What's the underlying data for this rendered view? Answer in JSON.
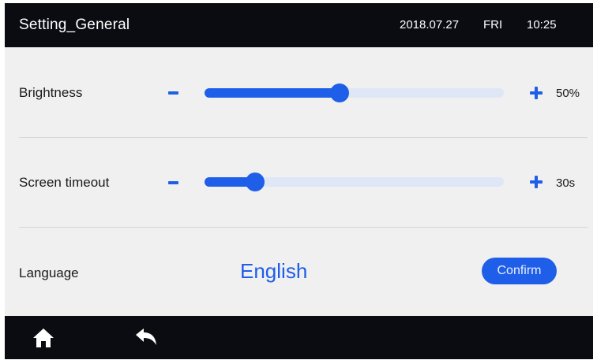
{
  "header": {
    "title": "Setting_General",
    "date": "2018.07.27",
    "day": "FRI",
    "time": "10:25"
  },
  "settings": {
    "brightness": {
      "label": "Brightness",
      "value_text": "50%",
      "level": 0.45
    },
    "screen_timeout": {
      "label": "Screen timeout",
      "value_text": "30s",
      "level": 0.17
    },
    "language": {
      "label": "Language",
      "value": "English",
      "confirm_label": "Confirm"
    }
  },
  "footer": {
    "home_icon": "home-icon",
    "back_icon": "back-arrow-icon"
  },
  "colors": {
    "accent": "#1f5ee8",
    "bar_background": "#0b0b12",
    "panel_background": "#f0f0f0",
    "track": "#dfe7f6"
  }
}
